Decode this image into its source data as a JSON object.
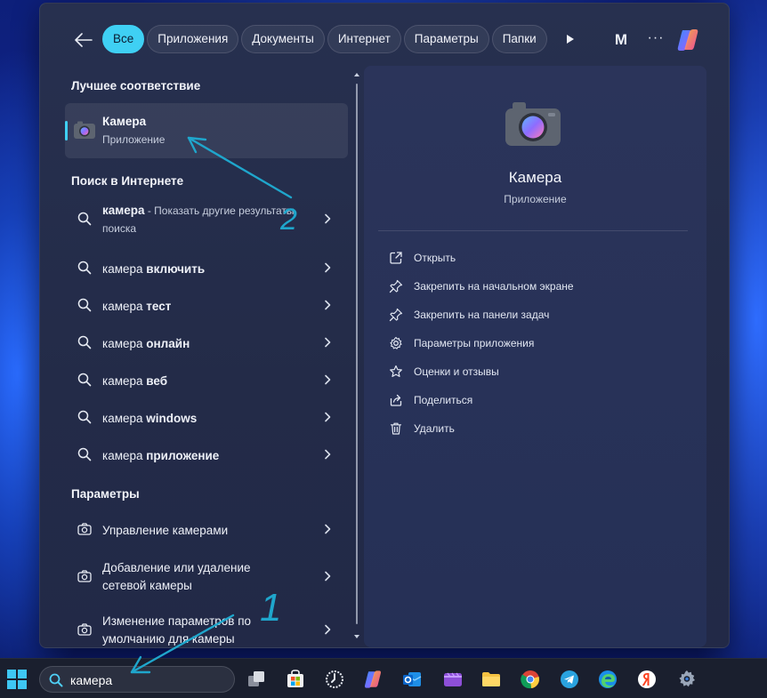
{
  "filters": {
    "back_label": "",
    "tabs": [
      "Все",
      "Приложения",
      "Документы",
      "Интернет",
      "Параметры",
      "Папки"
    ],
    "active_index": 0,
    "account_initial": "M",
    "more_label": "···"
  },
  "best_match": {
    "title": "Лучшее соответствие",
    "app_name": "Камера",
    "app_type": "Приложение"
  },
  "web": {
    "title": "Поиск в Интернете",
    "first": {
      "query": "камера",
      "suffix": " - Показать другие результаты поиска"
    },
    "items": [
      {
        "prefix": "камера ",
        "bold": "включить"
      },
      {
        "prefix": "камера ",
        "bold": "тест"
      },
      {
        "prefix": "камера ",
        "bold": "онлайн"
      },
      {
        "prefix": "камера ",
        "bold": "веб"
      },
      {
        "prefix": "камера ",
        "bold": "windows"
      },
      {
        "prefix": "камера ",
        "bold": "приложение"
      }
    ]
  },
  "settings": {
    "title": "Параметры",
    "items": [
      "Управление камерами",
      "Добавление или удаление сетевой камеры",
      "Изменение параметров по умолчанию для камеры"
    ]
  },
  "detail": {
    "app_name": "Камера",
    "app_type": "Приложение",
    "actions": [
      {
        "label": "Открыть",
        "icon": "open-external-icon"
      },
      {
        "label": "Закрепить на начальном экране",
        "icon": "pin-icon"
      },
      {
        "label": "Закрепить на панели задач",
        "icon": "pin-icon"
      },
      {
        "label": "Параметры приложения",
        "icon": "gear-icon"
      },
      {
        "label": "Оценки и отзывы",
        "icon": "star-icon"
      },
      {
        "label": "Поделиться",
        "icon": "share-icon"
      },
      {
        "label": "Удалить",
        "icon": "trash-icon"
      }
    ]
  },
  "taskbar": {
    "search_value": "камера",
    "apps": [
      "task-view",
      "microsoft-store",
      "clock",
      "copilot",
      "outlook",
      "clipchamp",
      "file-explorer",
      "chrome",
      "telegram",
      "edge",
      "yandex-browser",
      "settings"
    ]
  },
  "annotations": [
    "1",
    "2"
  ],
  "colors": {
    "accent": "#3fd0f4",
    "panel": "#27304f",
    "taskbar": "#1a1f2e"
  }
}
